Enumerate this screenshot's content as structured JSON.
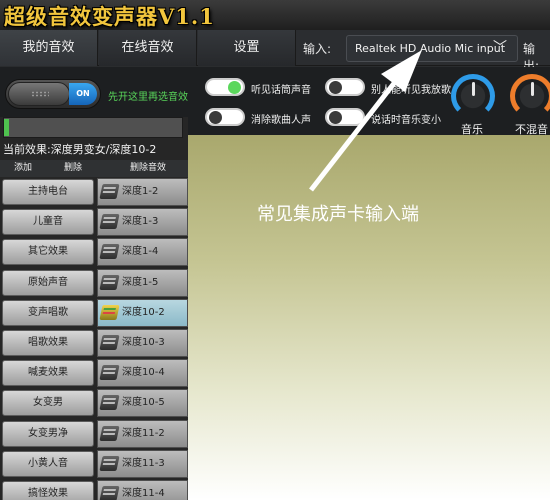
{
  "app": {
    "title": "超级音效变声器V1.1"
  },
  "tabs": [
    {
      "label": "我的音效"
    },
    {
      "label": "在线音效"
    },
    {
      "label": "设置"
    }
  ],
  "io": {
    "input_label": "输入:",
    "input_value": "Realtek HD Audio Mic input",
    "output_label": "输出:"
  },
  "main_switch": {
    "state_label": "ON",
    "hint": "先开这里再选音效"
  },
  "toggles": [
    {
      "label": "听见话筒声音",
      "on": true
    },
    {
      "label": "别人能听见我放歌",
      "on": false
    },
    {
      "label": "消除歌曲人声",
      "on": false
    },
    {
      "label": "说话时音乐变小",
      "on": false
    }
  ],
  "dials": [
    {
      "label": "音乐",
      "color": "#2e9be8"
    },
    {
      "label": "不混音",
      "color": "#ee7d2b"
    }
  ],
  "level_meter": {
    "value": 0.03
  },
  "current_effect": {
    "text": "当前效果:深度男变女/深度10-2"
  },
  "list_header": {
    "add": "添加",
    "delete": "删除",
    "delete_effect": "删除音效"
  },
  "categories": [
    "主持电台",
    "儿童音",
    "其它效果",
    "原始声音",
    "变声唱歌",
    "唱歌效果",
    "喊麦效果",
    "女变男",
    "女变男净",
    "小黄人音",
    "搞怪效果"
  ],
  "effects": [
    {
      "name": "深度1-2",
      "selected": false
    },
    {
      "name": "深度1-3",
      "selected": false
    },
    {
      "name": "深度1-4",
      "selected": false
    },
    {
      "name": "深度1-5",
      "selected": false
    },
    {
      "name": "深度10-2",
      "selected": true
    },
    {
      "name": "深度10-3",
      "selected": false
    },
    {
      "name": "深度10-4",
      "selected": false
    },
    {
      "name": "深度10-5",
      "selected": false
    },
    {
      "name": "深度11-2",
      "selected": false
    },
    {
      "name": "深度11-3",
      "selected": false
    },
    {
      "name": "深度11-4",
      "selected": false
    }
  ],
  "annotation": {
    "text": "常见集成声卡输入端"
  }
}
